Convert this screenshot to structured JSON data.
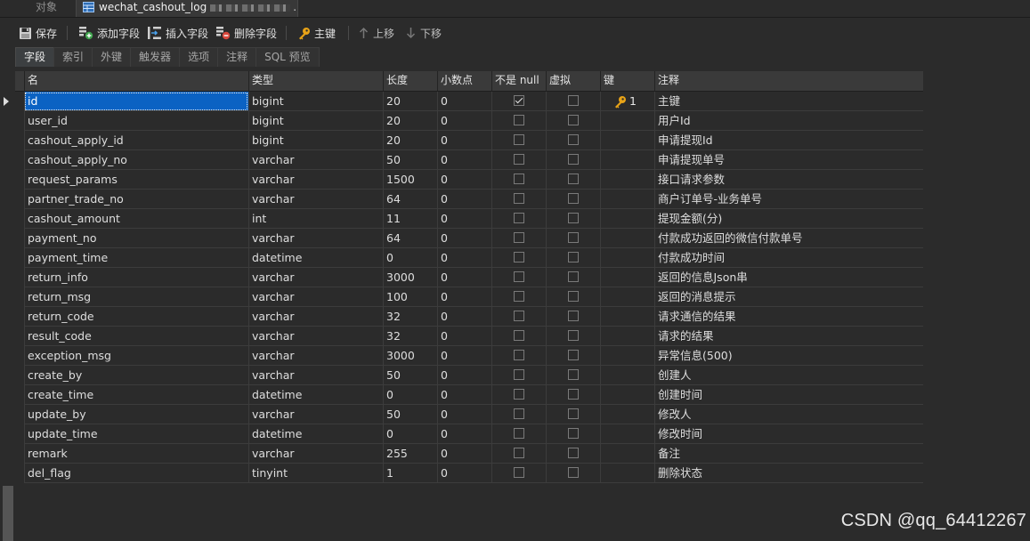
{
  "doc_tabs": {
    "objects_label": "对象",
    "active_label": "wechat_cashout_log",
    "ellipsis": "..."
  },
  "toolbar": {
    "save": "保存",
    "add_field": "添加字段",
    "insert_field": "插入字段",
    "delete_field": "删除字段",
    "primary_key": "主键",
    "move_up": "上移",
    "move_down": "下移"
  },
  "subtabs": [
    "字段",
    "索引",
    "外键",
    "触发器",
    "选项",
    "注释",
    "SQL 预览"
  ],
  "columns": {
    "name": "名",
    "type": "类型",
    "length": "长度",
    "decimals": "小数点",
    "not_null": "不是 null",
    "virtual": "虚拟",
    "key": "键",
    "comment": "注释"
  },
  "rows": [
    {
      "name": "id",
      "type": "bigint",
      "length": "20",
      "decimals": "0",
      "not_null": true,
      "virtual": false,
      "key": "1",
      "comment": "主键"
    },
    {
      "name": "user_id",
      "type": "bigint",
      "length": "20",
      "decimals": "0",
      "not_null": false,
      "virtual": false,
      "key": "",
      "comment": "用户Id"
    },
    {
      "name": "cashout_apply_id",
      "type": "bigint",
      "length": "20",
      "decimals": "0",
      "not_null": false,
      "virtual": false,
      "key": "",
      "comment": "申请提现Id"
    },
    {
      "name": "cashout_apply_no",
      "type": "varchar",
      "length": "50",
      "decimals": "0",
      "not_null": false,
      "virtual": false,
      "key": "",
      "comment": "申请提现单号"
    },
    {
      "name": "request_params",
      "type": "varchar",
      "length": "1500",
      "decimals": "0",
      "not_null": false,
      "virtual": false,
      "key": "",
      "comment": "接口请求参数"
    },
    {
      "name": "partner_trade_no",
      "type": "varchar",
      "length": "64",
      "decimals": "0",
      "not_null": false,
      "virtual": false,
      "key": "",
      "comment": "商户订单号-业务单号"
    },
    {
      "name": "cashout_amount",
      "type": "int",
      "length": "11",
      "decimals": "0",
      "not_null": false,
      "virtual": false,
      "key": "",
      "comment": "提现金额(分)"
    },
    {
      "name": "payment_no",
      "type": "varchar",
      "length": "64",
      "decimals": "0",
      "not_null": false,
      "virtual": false,
      "key": "",
      "comment": "付款成功返回的微信付款单号"
    },
    {
      "name": "payment_time",
      "type": "datetime",
      "length": "0",
      "decimals": "0",
      "not_null": false,
      "virtual": false,
      "key": "",
      "comment": "付款成功时间"
    },
    {
      "name": "return_info",
      "type": "varchar",
      "length": "3000",
      "decimals": "0",
      "not_null": false,
      "virtual": false,
      "key": "",
      "comment": "返回的信息Json串"
    },
    {
      "name": "return_msg",
      "type": "varchar",
      "length": "100",
      "decimals": "0",
      "not_null": false,
      "virtual": false,
      "key": "",
      "comment": "返回的消息提示"
    },
    {
      "name": "return_code",
      "type": "varchar",
      "length": "32",
      "decimals": "0",
      "not_null": false,
      "virtual": false,
      "key": "",
      "comment": "请求通信的结果"
    },
    {
      "name": "result_code",
      "type": "varchar",
      "length": "32",
      "decimals": "0",
      "not_null": false,
      "virtual": false,
      "key": "",
      "comment": "请求的结果"
    },
    {
      "name": "exception_msg",
      "type": "varchar",
      "length": "3000",
      "decimals": "0",
      "not_null": false,
      "virtual": false,
      "key": "",
      "comment": "异常信息(500)"
    },
    {
      "name": "create_by",
      "type": "varchar",
      "length": "50",
      "decimals": "0",
      "not_null": false,
      "virtual": false,
      "key": "",
      "comment": "创建人"
    },
    {
      "name": "create_time",
      "type": "datetime",
      "length": "0",
      "decimals": "0",
      "not_null": false,
      "virtual": false,
      "key": "",
      "comment": "创建时间"
    },
    {
      "name": "update_by",
      "type": "varchar",
      "length": "50",
      "decimals": "0",
      "not_null": false,
      "virtual": false,
      "key": "",
      "comment": "修改人"
    },
    {
      "name": "update_time",
      "type": "datetime",
      "length": "0",
      "decimals": "0",
      "not_null": false,
      "virtual": false,
      "key": "",
      "comment": "修改时间"
    },
    {
      "name": "remark",
      "type": "varchar",
      "length": "255",
      "decimals": "0",
      "not_null": false,
      "virtual": false,
      "key": "",
      "comment": "备注"
    },
    {
      "name": "del_flag",
      "type": "tinyint",
      "length": "1",
      "decimals": "0",
      "not_null": false,
      "virtual": false,
      "key": "",
      "comment": "删除状态"
    }
  ],
  "watermark": "CSDN @qq_64412267",
  "colors": {
    "background": "#2b2b2b",
    "selection": "#0b62c3",
    "key_icon": "#e8a317",
    "add_icon": "#3fa34d",
    "delete_icon": "#d9473c"
  }
}
